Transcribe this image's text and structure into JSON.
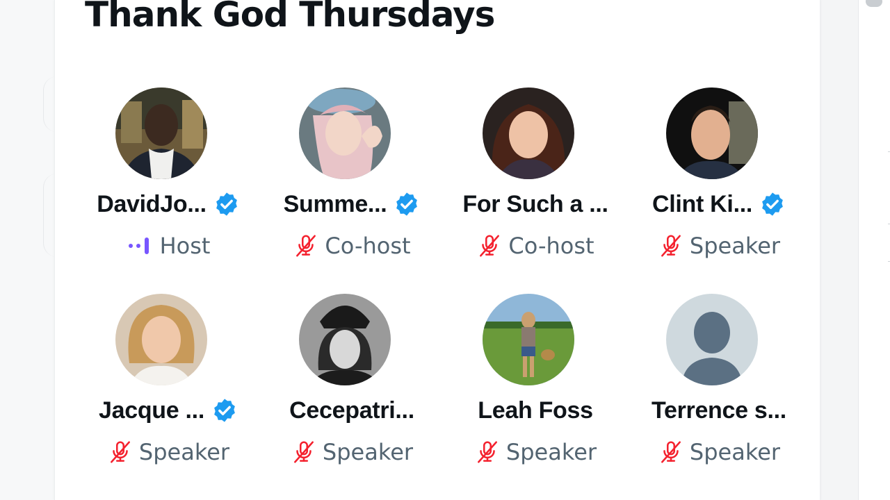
{
  "space": {
    "title": "Thank God Thursdays"
  },
  "colors": {
    "verified": "#1d9bf0",
    "muted_mic": "#f4212e",
    "speaking": "#7856ff",
    "role_text": "#536471",
    "name_text": "#0f1419"
  },
  "participants": [
    {
      "name": "DavidJo...",
      "role": "Host",
      "verified": true,
      "status": "speaking-icon"
    },
    {
      "name": "Summe...",
      "role": "Co-host",
      "verified": true,
      "status": "mic-muted-icon"
    },
    {
      "name": "For Such a ...",
      "role": "Co-host",
      "verified": false,
      "status": "mic-muted-icon"
    },
    {
      "name": "Clint Ki...",
      "role": "Speaker",
      "verified": true,
      "status": "mic-muted-icon"
    },
    {
      "name": "Jacque ...",
      "role": "Speaker",
      "verified": true,
      "status": "mic-muted-icon"
    },
    {
      "name": "Cecepatri...",
      "role": "Speaker",
      "verified": false,
      "status": "mic-muted-icon"
    },
    {
      "name": "Leah Foss",
      "role": "Speaker",
      "verified": false,
      "status": "mic-muted-icon"
    },
    {
      "name": "Terrence s...",
      "role": "Speaker",
      "verified": false,
      "status": "mic-muted-icon"
    }
  ]
}
